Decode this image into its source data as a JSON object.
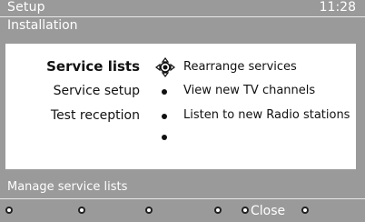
{
  "header": {
    "title": "Setup",
    "clock": "11:28",
    "submenu": "Installation"
  },
  "menu": {
    "left_items": [
      {
        "label": "Service lists",
        "active": true
      },
      {
        "label": "Service setup",
        "active": false
      },
      {
        "label": "Test reception",
        "active": false
      }
    ],
    "right_items": [
      {
        "label": "Rearrange services"
      },
      {
        "label": "View new TV channels"
      },
      {
        "label": "Listen to new Radio stations"
      }
    ]
  },
  "status": {
    "text": "Manage service lists"
  },
  "footer": {
    "close_label": "Close"
  },
  "icons": {
    "navigation": "dpad-icon",
    "bullet": "bullet-icon",
    "function_key": "function-key-icon"
  },
  "colors": {
    "background": "#9a9a9a",
    "panel": "#ffffff",
    "text_on_bg": "#ffffff",
    "text_on_panel": "#111111"
  }
}
